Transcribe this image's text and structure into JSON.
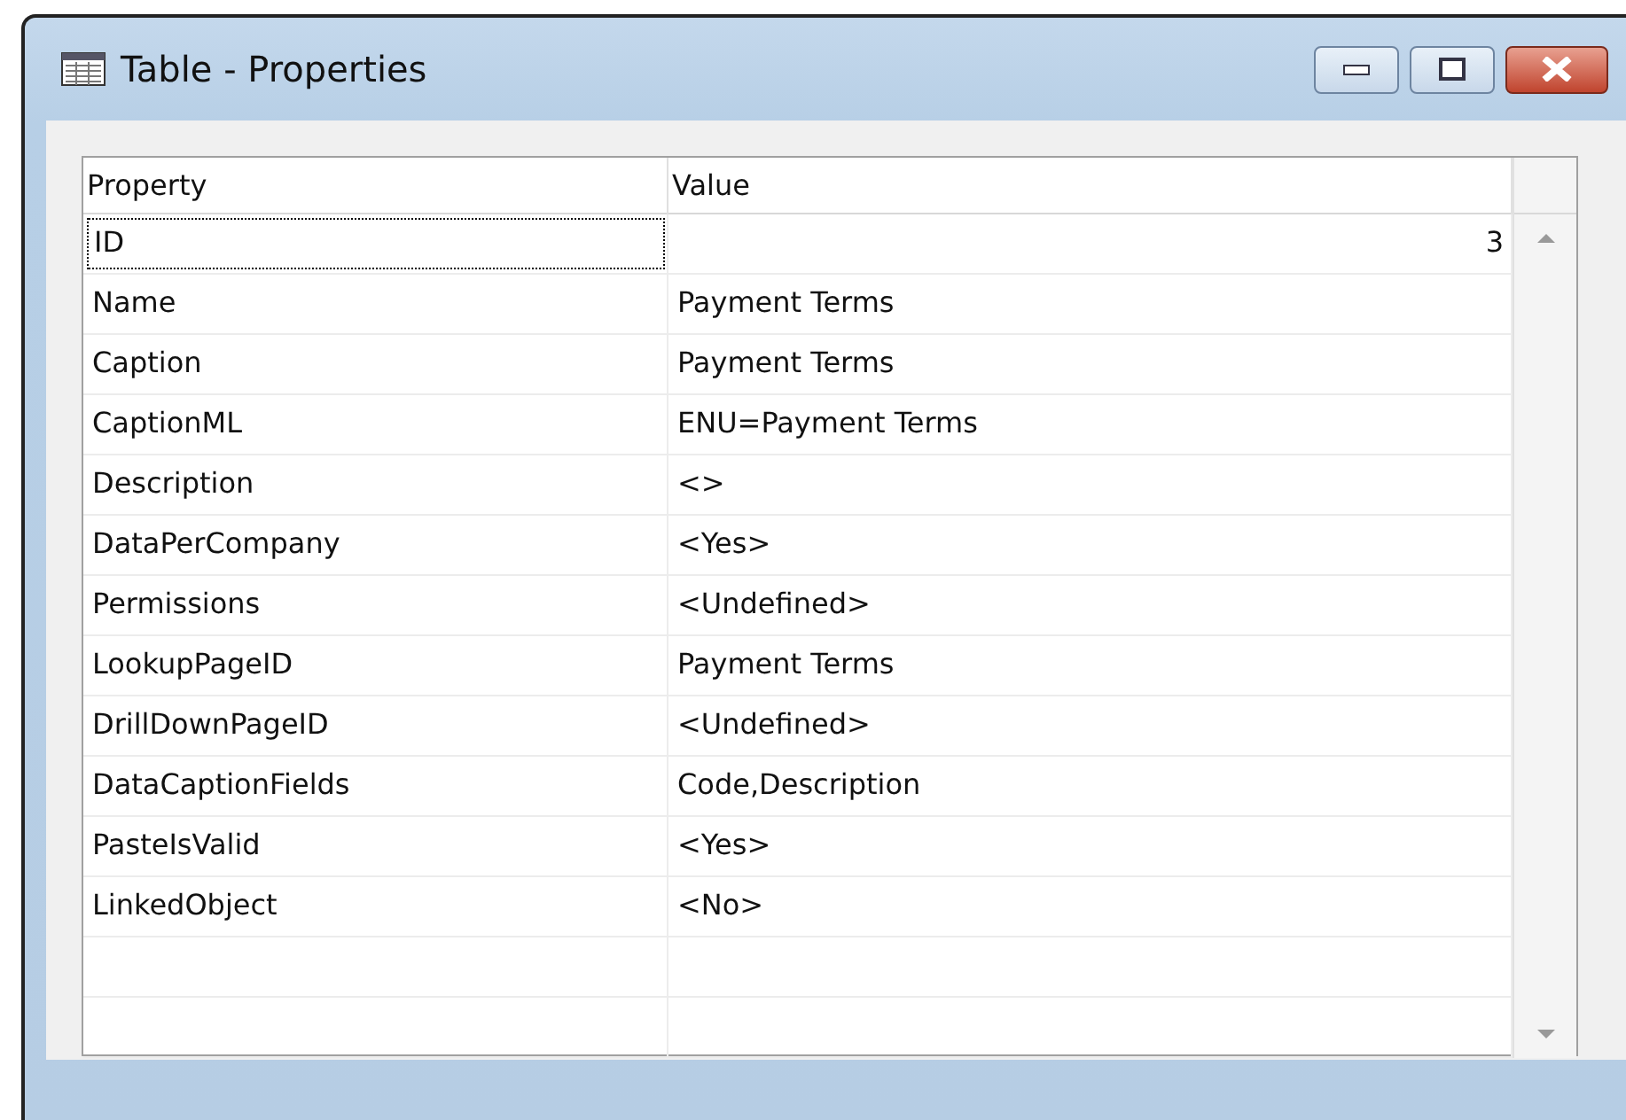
{
  "window": {
    "title": "Table - Properties"
  },
  "table": {
    "columns": [
      "Property",
      "Value"
    ],
    "rows": [
      {
        "property": "ID",
        "value": "3",
        "kind": "number",
        "selected": true
      },
      {
        "property": "Name",
        "value": "Payment Terms",
        "kind": "text",
        "selected": false
      },
      {
        "property": "Caption",
        "value": "Payment Terms",
        "kind": "text",
        "selected": false
      },
      {
        "property": "CaptionML",
        "value": "ENU=Payment Terms",
        "kind": "text",
        "selected": false
      },
      {
        "property": "Description",
        "value": "<>",
        "kind": "text",
        "selected": false
      },
      {
        "property": "DataPerCompany",
        "value": "<Yes>",
        "kind": "text",
        "selected": false
      },
      {
        "property": "Permissions",
        "value": "<Undefined>",
        "kind": "text",
        "selected": false
      },
      {
        "property": "LookupPageID",
        "value": "Payment Terms",
        "kind": "text",
        "selected": false
      },
      {
        "property": "DrillDownPageID",
        "value": "<Undefined>",
        "kind": "text",
        "selected": false
      },
      {
        "property": "DataCaptionFields",
        "value": "Code,Description",
        "kind": "text",
        "selected": false
      },
      {
        "property": "PasteIsValid",
        "value": "<Yes>",
        "kind": "text",
        "selected": false
      },
      {
        "property": "LinkedObject",
        "value": "<No>",
        "kind": "text",
        "selected": false
      }
    ]
  }
}
